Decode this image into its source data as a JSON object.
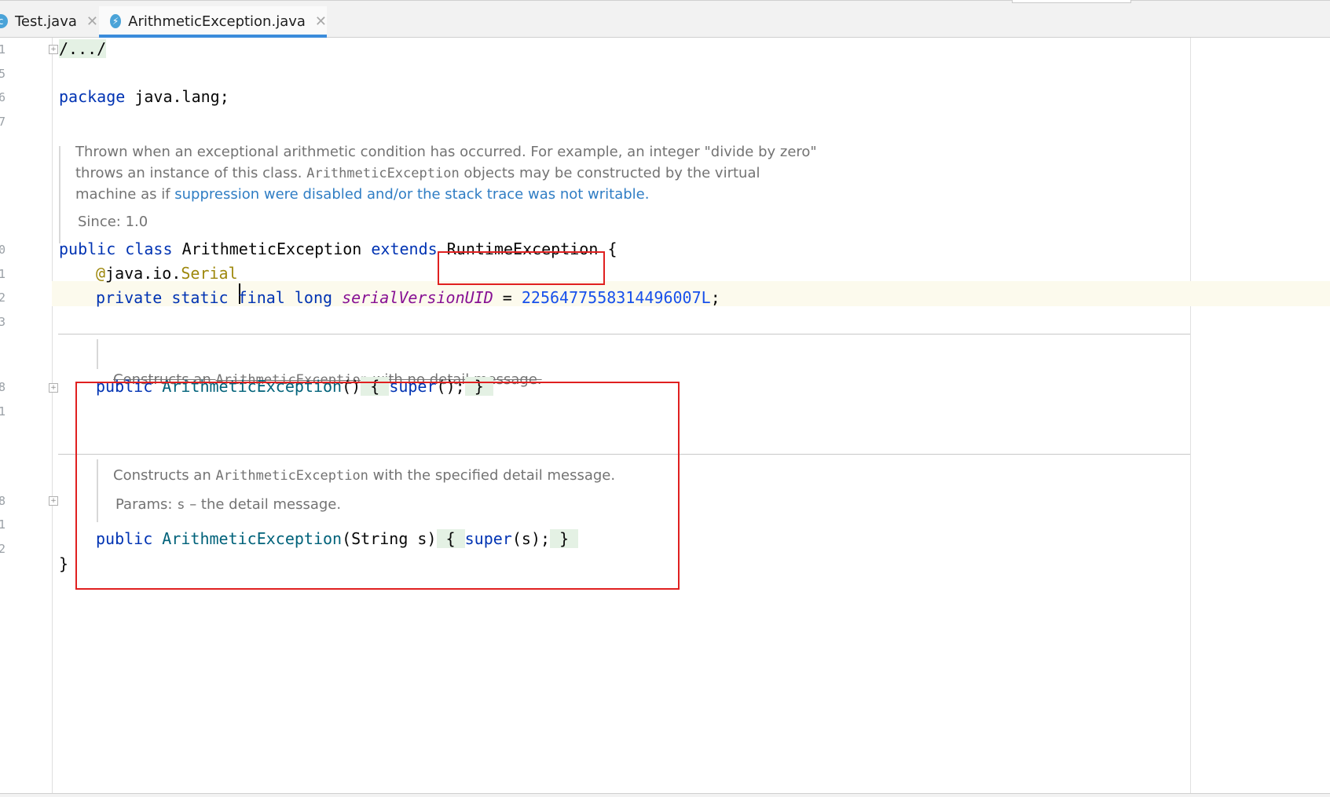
{
  "tabs": [
    {
      "label": "Test.java",
      "icon": "java-class-icon",
      "active": false
    },
    {
      "label": "ArithmeticException.java",
      "icon": "java-exception-class-icon",
      "active": true
    }
  ],
  "gutter": {
    "line_numbers": [
      "1",
      "5",
      "6",
      "7",
      "0",
      "1",
      "2",
      "3",
      "8",
      "1",
      "8",
      "1",
      "2"
    ]
  },
  "code": {
    "fold_header": "/.../",
    "pkg_kw": "package",
    "pkg_name": " java.lang;",
    "doc1": {
      "line1": "Thrown when an exceptional arithmetic condition has occurred. For example, an integer \"divide by zero\"",
      "line2_a": "throws an instance of this class. ",
      "line2_mono": "ArithmeticException",
      "line2_b": " objects may be constructed by the virtual",
      "line3_a": "machine as if ",
      "line3_link": "suppression were disabled and/or the stack trace was not writable",
      "line3_b": ".",
      "since": "Since:  1.0"
    },
    "class_decl": {
      "kw1": "public",
      "kw2": "class",
      "name": "ArithmeticException",
      "kw3": "extends",
      "super": "RuntimeException",
      "brace": "{"
    },
    "annotation": {
      "at": "@",
      "pkg": "java.io.",
      "name": "Serial"
    },
    "field": {
      "kw": "private static final long",
      "name": "serialVersionUID",
      "eq": " = ",
      "value": "2256477558314496007L",
      "semi": ";"
    },
    "doc2": {
      "a": "Constructs an ",
      "mono": "ArithmeticException",
      "b": " with no detail message."
    },
    "ctor1": {
      "kw": "public",
      "name": "ArithmeticException",
      "args": "()",
      "open": "{",
      "body_kw": "super",
      "body_rest": "();",
      "close": "}"
    },
    "doc3": {
      "a": "Constructs an ",
      "mono": "ArithmeticException",
      "b": " with the specified detail message.",
      "params_a": "Params:  ",
      "params_mono": "s",
      "params_b": " – the detail message."
    },
    "ctor2": {
      "kw": "public",
      "name": "ArithmeticException",
      "args": "(String s)",
      "open": "{",
      "body_kw": "super",
      "body_rest": "(s);",
      "close": "}"
    },
    "class_close": "}"
  },
  "colors": {
    "keyword": "#0033b3",
    "annotation": "#9e880d",
    "field": "#871094",
    "number": "#1750eb",
    "highlight": "#e02020"
  }
}
